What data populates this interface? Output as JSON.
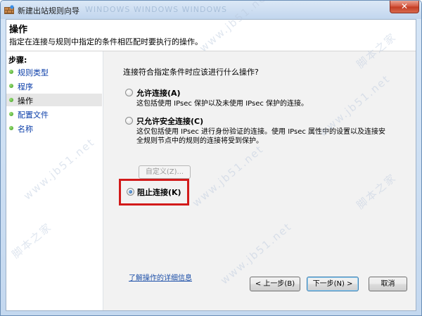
{
  "window": {
    "title": "新建出站规则向导",
    "title_ghost": "WINDOWS    WINDOWS    WINDOWS",
    "close_symbol": "✕"
  },
  "header": {
    "title": "操作",
    "description": "指定在连接与规则中指定的条件相匹配时要执行的操作。"
  },
  "sidebar": {
    "steps_label": "步骤:",
    "items": [
      {
        "label": "规则类型",
        "state": "link"
      },
      {
        "label": "程序",
        "state": "link"
      },
      {
        "label": "操作",
        "state": "current"
      },
      {
        "label": "配置文件",
        "state": "link"
      },
      {
        "label": "名称",
        "state": "link"
      }
    ]
  },
  "main": {
    "question": "连接符合指定条件时应该进行什么操作?",
    "options": [
      {
        "label": "允许连接(A)",
        "selected": false,
        "desc": [
          "这包括使用 IPsec 保护以及未使用 IPsec 保护的连接。"
        ]
      },
      {
        "label": "只允许安全连接(C)",
        "selected": false,
        "desc": [
          "这仅包括使用 IPsec 进行身份验证的连接。使用 IPsec 属性中的设置以及连接安",
          "全规则节点中的规则的连接将受到保护。"
        ]
      },
      {
        "label": "阻止连接(K)",
        "selected": true,
        "desc": []
      }
    ],
    "customize_label": "自定义(Z)...",
    "learn_more": "了解操作的详细信息"
  },
  "footer": {
    "back": "< 上一步(B)",
    "next": "下一步(N) >",
    "cancel": "取消"
  },
  "watermark": {
    "text1": "www.jb51.net",
    "text2": "脚本之家"
  },
  "colors": {
    "link": "#0a3da8",
    "highlight_border": "#d21a1a",
    "step_dot": "#3c9b1e"
  }
}
